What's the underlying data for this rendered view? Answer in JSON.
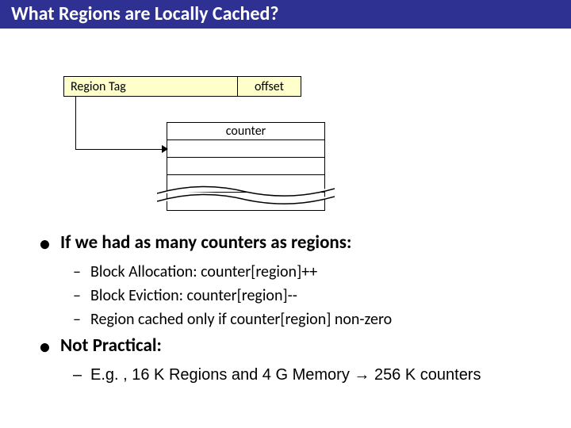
{
  "title": "What Regions are Locally Cached?",
  "diagram": {
    "region_tag_label": "Region Tag",
    "offset_label": "offset",
    "counter_label": "counter"
  },
  "bullets": {
    "main1": "If we had as many counters as regions:",
    "sub1a": "Block Allocation: counter[region]++",
    "sub1b": "Block Eviction: counter[region]--",
    "sub1c": "Region cached only if counter[region] non-zero",
    "main2": "Not Practical:",
    "sub2a": "E.g. , 16 K Regions and 4 G Memory → 256 K counters"
  }
}
